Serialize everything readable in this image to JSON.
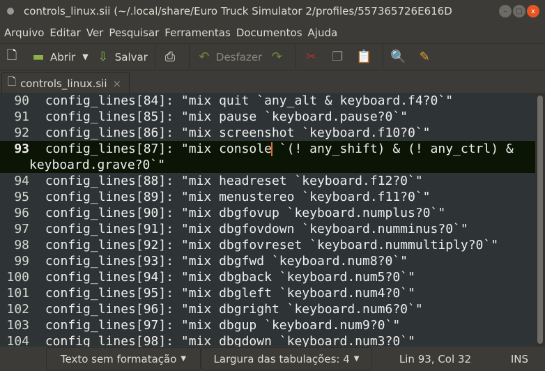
{
  "window": {
    "title": "controls_linux.sii (~/.local/share/Euro Truck Simulator 2/profiles/557365726E616D"
  },
  "menu": [
    "Arquivo",
    "Editar",
    "Ver",
    "Pesquisar",
    "Ferramentas",
    "Documentos",
    "Ajuda"
  ],
  "toolbar": {
    "open": "Abrir",
    "save": "Salvar",
    "undo": "Desfazer"
  },
  "tab": {
    "label": "controls_linux.sii"
  },
  "lines": [
    {
      "n": "90",
      "t": " config_lines[84]: \"mix quit `any_alt & keyboard.f4?0`\""
    },
    {
      "n": "91",
      "t": " config_lines[85]: \"mix pause `keyboard.pause?0`\""
    },
    {
      "n": "92",
      "t": " config_lines[86]: \"mix screenshot `keyboard.f10?0`\""
    },
    {
      "n": "94",
      "t": " config_lines[88]: \"mix headreset `keyboard.f12?0`\""
    },
    {
      "n": "95",
      "t": " config_lines[89]: \"mix menustereo `keyboard.f11?0`\""
    },
    {
      "n": "96",
      "t": " config_lines[90]: \"mix dbgfovup `keyboard.numplus?0`\""
    },
    {
      "n": "97",
      "t": " config_lines[91]: \"mix dbgfovdown `keyboard.numminus?0`\""
    },
    {
      "n": "98",
      "t": " config_lines[92]: \"mix dbgfovreset `keyboard.nummultiply?0`\""
    },
    {
      "n": "99",
      "t": " config_lines[93]: \"mix dbgfwd `keyboard.num8?0`\""
    },
    {
      "n": "100",
      "t": " config_lines[94]: \"mix dbgback `keyboard.num5?0`\""
    },
    {
      "n": "101",
      "t": " config_lines[95]: \"mix dbgleft `keyboard.num4?0`\""
    },
    {
      "n": "102",
      "t": " config_lines[96]: \"mix dbgright `keyboard.num6?0`\""
    },
    {
      "n": "103",
      "t": " config_lines[97]: \"mix dbgup `keyboard.num9?0`\""
    },
    {
      "n": "104",
      "t": " config_lines[98]: \"mix dbgdown `keyboard.num3?0`\""
    }
  ],
  "current": {
    "n": "93",
    "before": " config_lines[87]: \"mix console",
    "after": " `(! any_shift) & (! any_ctrl) &",
    "wrap": "keyboard.grave?0`\""
  },
  "status": {
    "language": "Texto sem formatação",
    "tabwidth": "Largura das tabulações: 4",
    "position": "Lin 93, Col 32",
    "mode": "INS"
  }
}
